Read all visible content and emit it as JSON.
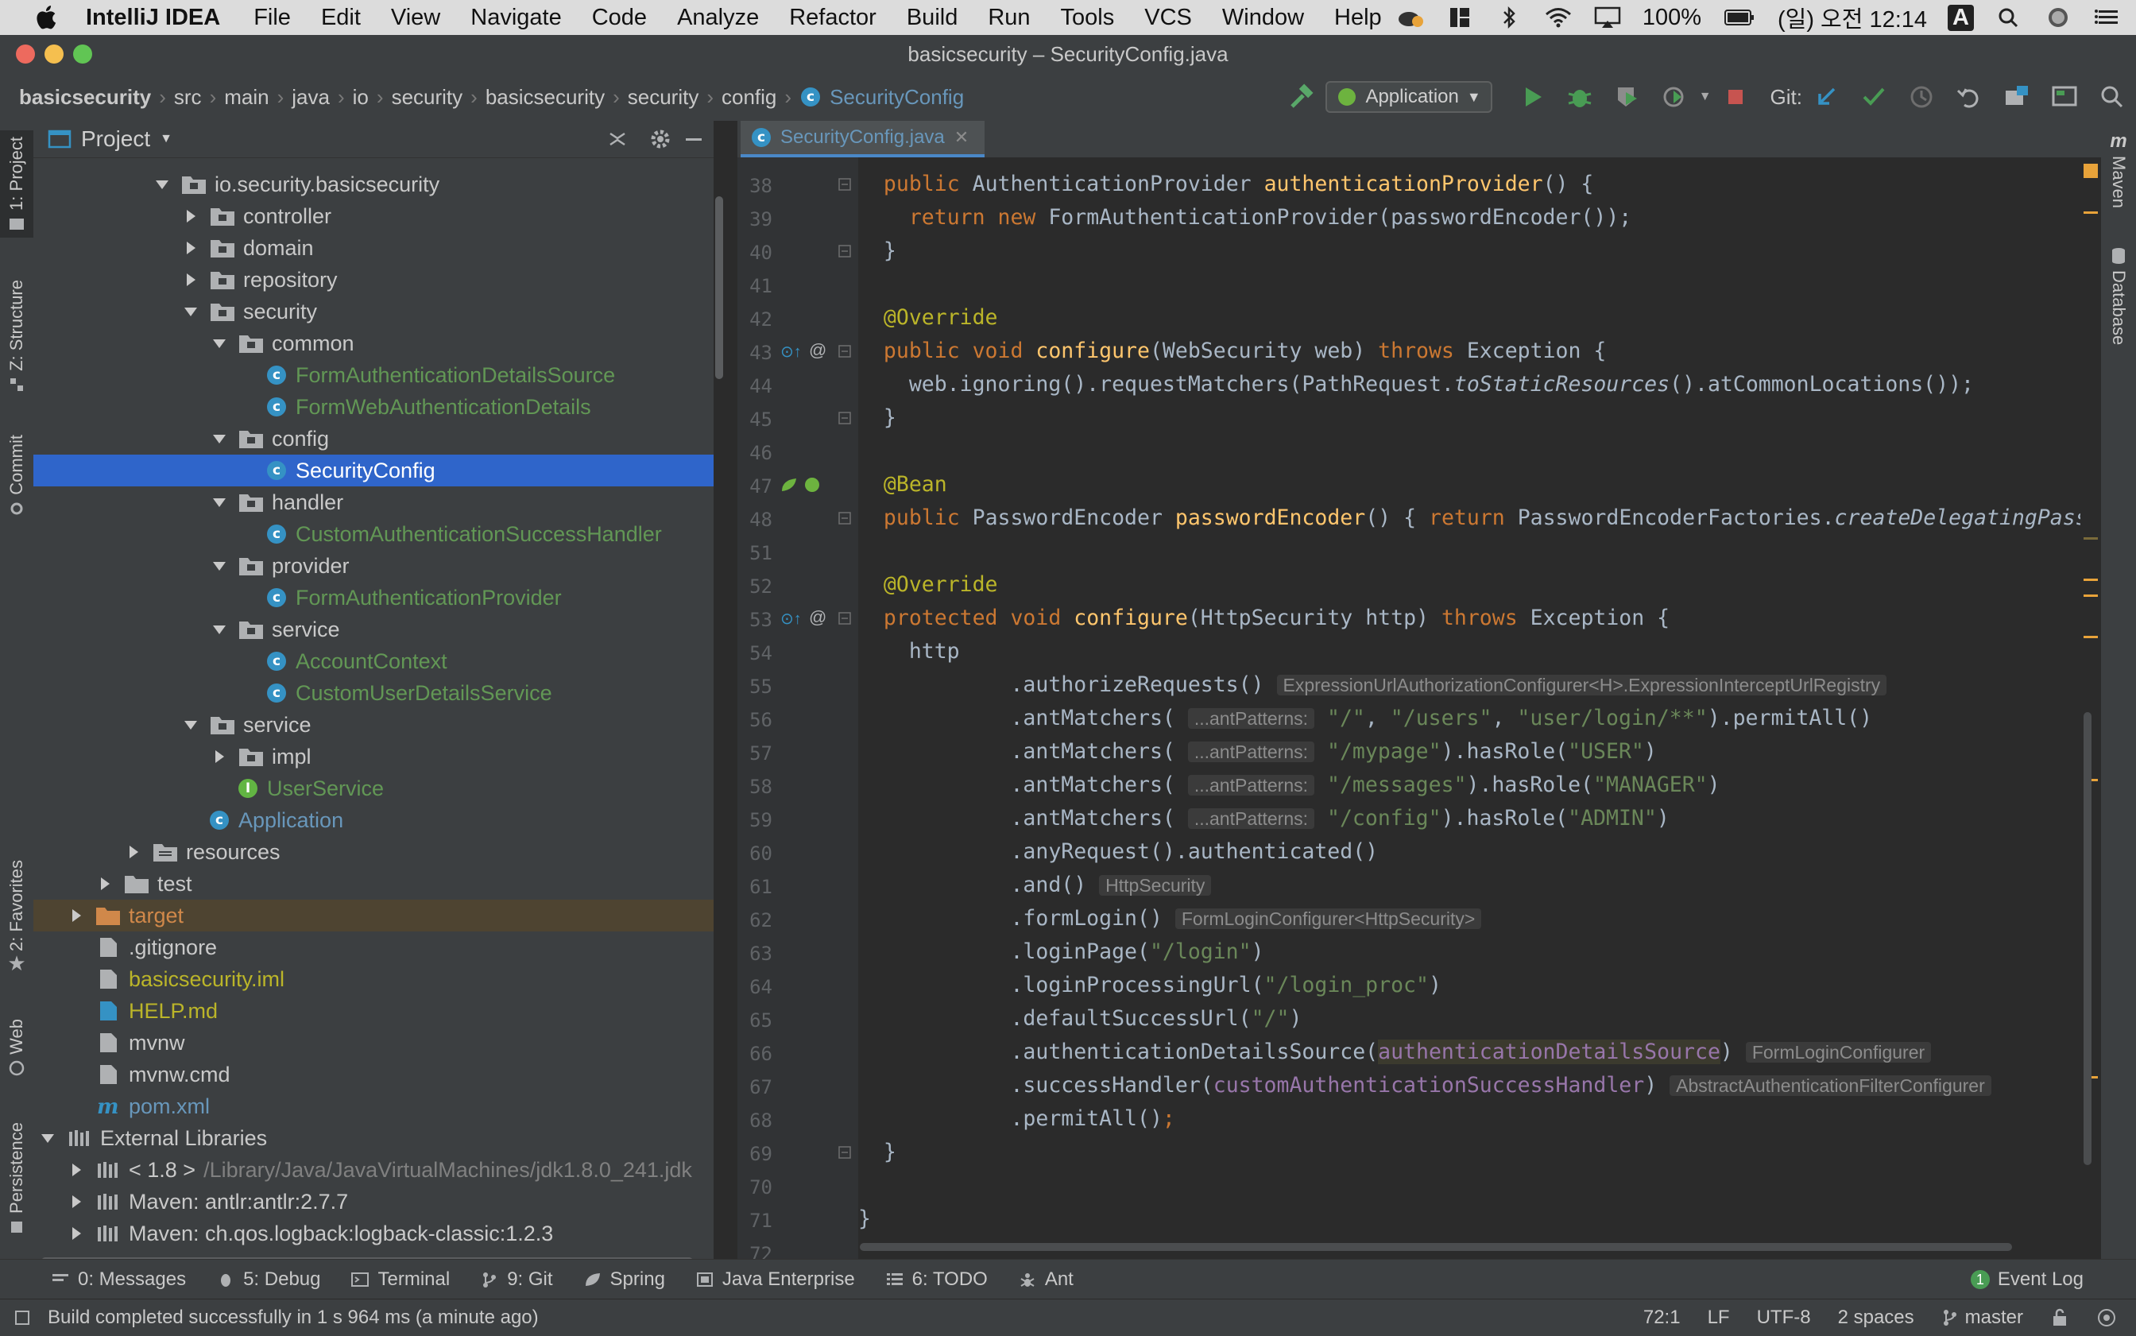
{
  "menubar": {
    "app_name": "IntelliJ IDEA",
    "items": [
      "File",
      "Edit",
      "View",
      "Navigate",
      "Code",
      "Analyze",
      "Refactor",
      "Build",
      "Run",
      "Tools",
      "VCS",
      "Window",
      "Help"
    ],
    "battery": "100%",
    "clock": "(일) 오전 12:14",
    "input_source": "A"
  },
  "window": {
    "title": "basicsecurity – SecurityConfig.java"
  },
  "breadcrumbs": [
    "basicsecurity",
    "src",
    "main",
    "java",
    "io",
    "security",
    "basicsecurity",
    "security",
    "config",
    "SecurityConfig"
  ],
  "toolbar": {
    "run_config": "Application",
    "git_label": "Git:"
  },
  "left_strip": {
    "project": "1: Project",
    "structure": "Z: Structure",
    "commit": "Commit",
    "favorites": "2: Favorites",
    "web": "Web",
    "persistence": "Persistence"
  },
  "right_strip": {
    "maven": "Maven",
    "database": "Database"
  },
  "project_panel": {
    "title": "Project",
    "tree": [
      {
        "label": "io.security.basicsecurity",
        "kind": "package",
        "indent": 3,
        "expanded": true
      },
      {
        "label": "controller",
        "kind": "package",
        "indent": 4,
        "expanded": false
      },
      {
        "label": "domain",
        "kind": "package",
        "indent": 4,
        "expanded": false
      },
      {
        "label": "repository",
        "kind": "package",
        "indent": 4,
        "expanded": false
      },
      {
        "label": "security",
        "kind": "package",
        "indent": 4,
        "expanded": true
      },
      {
        "label": "common",
        "kind": "package",
        "indent": 5,
        "expanded": true
      },
      {
        "label": "FormAuthenticationDetailsSource",
        "kind": "class",
        "indent": 6
      },
      {
        "label": "FormWebAuthenticationDetails",
        "kind": "class",
        "indent": 6
      },
      {
        "label": "config",
        "kind": "package",
        "indent": 5,
        "expanded": true
      },
      {
        "label": "SecurityConfig",
        "kind": "class",
        "indent": 6,
        "selected": true
      },
      {
        "label": "handler",
        "kind": "package",
        "indent": 5,
        "expanded": true
      },
      {
        "label": "CustomAuthenticationSuccessHandler",
        "kind": "class",
        "indent": 6
      },
      {
        "label": "provider",
        "kind": "package",
        "indent": 5,
        "expanded": true
      },
      {
        "label": "FormAuthenticationProvider",
        "kind": "class",
        "indent": 6
      },
      {
        "label": "service",
        "kind": "package",
        "indent": 5,
        "expanded": true
      },
      {
        "label": "AccountContext",
        "kind": "class",
        "indent": 6
      },
      {
        "label": "CustomUserDetailsService",
        "kind": "class",
        "indent": 6
      },
      {
        "label": "service",
        "kind": "package",
        "indent": 4,
        "expanded": true
      },
      {
        "label": "impl",
        "kind": "package",
        "indent": 5,
        "expanded": false
      },
      {
        "label": "UserService",
        "kind": "interface",
        "indent": 5
      },
      {
        "label": "Application",
        "kind": "app",
        "indent": 4
      },
      {
        "label": "resources",
        "kind": "resfolder",
        "indent": 2,
        "expanded": false
      },
      {
        "label": "test",
        "kind": "folder",
        "indent": 1,
        "expanded": false
      },
      {
        "label": "target",
        "kind": "target",
        "indent": 0,
        "expanded": false
      },
      {
        "label": ".gitignore",
        "kind": "file",
        "indent": 0
      },
      {
        "label": "basicsecurity.iml",
        "kind": "iml",
        "indent": 0
      },
      {
        "label": "HELP.md",
        "kind": "md",
        "indent": 0
      },
      {
        "label": "mvnw",
        "kind": "file",
        "indent": 0
      },
      {
        "label": "mvnw.cmd",
        "kind": "file",
        "indent": 0
      },
      {
        "label": "pom.xml",
        "kind": "maven",
        "indent": 0
      },
      {
        "label": "External Libraries",
        "kind": "libroot",
        "indent": -1,
        "expanded": true
      },
      {
        "label": "< 1.8 >",
        "extra": "/Library/Java/JavaVirtualMachines/jdk1.8.0_241.jdk",
        "kind": "jdk",
        "indent": 0,
        "expanded": false
      },
      {
        "label": "Maven: antlr:antlr:2.7.7",
        "kind": "lib",
        "indent": 0,
        "expanded": false
      },
      {
        "label": "Maven: ch.qos.logback:logback-classic:1.2.3",
        "kind": "lib",
        "indent": 0,
        "expanded": false
      }
    ]
  },
  "editor": {
    "tab": "SecurityConfig.java",
    "lines": [
      {
        "n": "38",
        "segs": [
          [
            "  ",
            ""
          ],
          [
            "public ",
            "kw"
          ],
          [
            "AuthenticationProvider ",
            ""
          ],
          [
            "authenticationProvider",
            "fn"
          ],
          [
            "() {",
            ""
          ]
        ]
      },
      {
        "n": "39",
        "segs": [
          [
            "    ",
            ""
          ],
          [
            "return new ",
            "kw"
          ],
          [
            "FormAuthenticationProvider(passwordEncoder());",
            ""
          ]
        ]
      },
      {
        "n": "40",
        "segs": [
          [
            "  }",
            ""
          ]
        ]
      },
      {
        "n": "41",
        "segs": []
      },
      {
        "n": "42",
        "segs": [
          [
            "  ",
            ""
          ],
          [
            "@Override",
            "ann"
          ]
        ]
      },
      {
        "n": "43",
        "segs": [
          [
            "  ",
            ""
          ],
          [
            "public void ",
            "kw"
          ],
          [
            "configure",
            "fn"
          ],
          [
            "(WebSecurity web) ",
            ""
          ],
          [
            "throws ",
            "kw"
          ],
          [
            "Exception {",
            ""
          ]
        ]
      },
      {
        "n": "44",
        "segs": [
          [
            "    web.ignoring().requestMatchers(PathRequest.",
            ""
          ],
          [
            "toStaticResources",
            "it"
          ],
          [
            "().atCommonLocations());",
            ""
          ]
        ]
      },
      {
        "n": "45",
        "segs": [
          [
            "  }",
            ""
          ]
        ]
      },
      {
        "n": "46",
        "segs": []
      },
      {
        "n": "47",
        "segs": [
          [
            "  ",
            ""
          ],
          [
            "@Bean",
            "ann"
          ]
        ]
      },
      {
        "n": "48",
        "segs": [
          [
            "  ",
            ""
          ],
          [
            "public ",
            "kw"
          ],
          [
            "PasswordEncoder ",
            ""
          ],
          [
            "passwordEncoder",
            "fn"
          ],
          [
            "() { ",
            ""
          ],
          [
            "return ",
            "kw"
          ],
          [
            "PasswordEncoderFactories.",
            ""
          ],
          [
            "createDelegatingPasswordEncoder",
            "it"
          ]
        ]
      },
      {
        "n": "51",
        "segs": []
      },
      {
        "n": "52",
        "segs": [
          [
            "  ",
            ""
          ],
          [
            "@Override",
            "ann"
          ]
        ]
      },
      {
        "n": "53",
        "segs": [
          [
            "  ",
            ""
          ],
          [
            "protected void ",
            "kw"
          ],
          [
            "configure",
            "fn"
          ],
          [
            "(HttpSecurity http) ",
            ""
          ],
          [
            "throws ",
            "kw"
          ],
          [
            "Exception {",
            ""
          ]
        ]
      },
      {
        "n": "54",
        "segs": [
          [
            "    http",
            ""
          ]
        ]
      },
      {
        "n": "55",
        "segs": [
          [
            "            .authorizeRequests() ",
            ""
          ],
          [
            "ExpressionUrlAuthorizationConfigurer<H>.ExpressionInterceptUrlRegistry",
            "hint"
          ]
        ]
      },
      {
        "n": "56",
        "segs": [
          [
            "            .antMatchers( ",
            ""
          ],
          [
            "...antPatterns:",
            "hint"
          ],
          [
            " ",
            ""
          ],
          [
            "\"/\"",
            "str"
          ],
          [
            ", ",
            ""
          ],
          [
            "\"/users\"",
            "str"
          ],
          [
            ", ",
            ""
          ],
          [
            "\"user/login/**\"",
            "str"
          ],
          [
            ").permitAll()",
            ""
          ]
        ]
      },
      {
        "n": "57",
        "segs": [
          [
            "            .antMatchers( ",
            ""
          ],
          [
            "...antPatterns:",
            "hint"
          ],
          [
            " ",
            ""
          ],
          [
            "\"/mypage\"",
            "str"
          ],
          [
            ").hasRole(",
            ""
          ],
          [
            "\"USER\"",
            "str"
          ],
          [
            ")",
            ""
          ]
        ]
      },
      {
        "n": "58",
        "segs": [
          [
            "            .antMatchers( ",
            ""
          ],
          [
            "...antPatterns:",
            "hint"
          ],
          [
            " ",
            ""
          ],
          [
            "\"/messages\"",
            "str"
          ],
          [
            ").hasRole(",
            ""
          ],
          [
            "\"MANAGER\"",
            "str"
          ],
          [
            ")",
            ""
          ]
        ]
      },
      {
        "n": "59",
        "segs": [
          [
            "            .antMatchers( ",
            ""
          ],
          [
            "...antPatterns:",
            "hint"
          ],
          [
            " ",
            ""
          ],
          [
            "\"/config\"",
            "str"
          ],
          [
            ").hasRole(",
            ""
          ],
          [
            "\"ADMIN\"",
            "str"
          ],
          [
            ")",
            ""
          ]
        ]
      },
      {
        "n": "60",
        "segs": [
          [
            "            .anyRequest().authenticated()",
            ""
          ]
        ]
      },
      {
        "n": "61",
        "segs": [
          [
            "            .and() ",
            ""
          ],
          [
            "HttpSecurity",
            "hint"
          ]
        ]
      },
      {
        "n": "62",
        "segs": [
          [
            "            .formLogin() ",
            ""
          ],
          [
            "FormLoginConfigurer<HttpSecurity>",
            "hint"
          ]
        ]
      },
      {
        "n": "63",
        "segs": [
          [
            "            .loginPage(",
            ""
          ],
          [
            "\"/login\"",
            "str"
          ],
          [
            ")",
            ""
          ]
        ]
      },
      {
        "n": "64",
        "segs": [
          [
            "            .loginProcessingUrl(",
            ""
          ],
          [
            "\"/login_proc\"",
            "str"
          ],
          [
            ")",
            ""
          ]
        ]
      },
      {
        "n": "65",
        "segs": [
          [
            "            .defaultSuccessUrl(",
            ""
          ],
          [
            "\"/\"",
            "str"
          ],
          [
            ")",
            ""
          ]
        ]
      },
      {
        "n": "66",
        "segs": [
          [
            "            .authenticationDetailsSource(",
            ""
          ],
          [
            "authenticationDetailsSource",
            "fieldbox"
          ],
          [
            ") ",
            ""
          ],
          [
            "FormLoginConfigurer",
            "hint"
          ]
        ]
      },
      {
        "n": "67",
        "segs": [
          [
            "            .successHandler(",
            ""
          ],
          [
            "customAuthenticationSuccessHandler",
            "fieldhl"
          ],
          [
            ") ",
            ""
          ],
          [
            "AbstractAuthenticationFilterConfigurer",
            "hint"
          ]
        ]
      },
      {
        "n": "68",
        "segs": [
          [
            "            .permitAll()",
            ""
          ],
          [
            ";",
            "kw"
          ]
        ]
      },
      {
        "n": "69",
        "segs": [
          [
            "  }",
            ""
          ]
        ]
      },
      {
        "n": "70",
        "segs": []
      },
      {
        "n": "71",
        "segs": [
          [
            "}",
            ""
          ]
        ]
      },
      {
        "n": "72",
        "segs": []
      }
    ]
  },
  "bottom_tabs": [
    "0: Messages",
    "5: Debug",
    "Terminal",
    "9: Git",
    "Spring",
    "Java Enterprise",
    "6: TODO",
    "Ant"
  ],
  "event_log": {
    "count": "1",
    "label": "Event Log"
  },
  "status": {
    "message": "Build completed successfully in 1 s 964 ms (a minute ago)",
    "position": "72:1",
    "line_sep": "LF",
    "encoding": "UTF-8",
    "indent": "2 spaces",
    "branch": "master"
  }
}
